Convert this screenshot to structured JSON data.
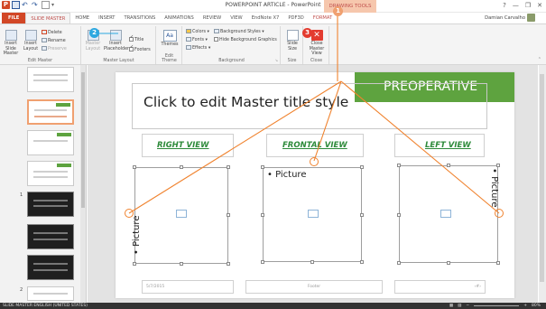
{
  "window": {
    "title": "POWERPOINT ARTICLE - PowerPoint",
    "context_tools": "DRAWING TOOLS",
    "controls": [
      "?",
      "—",
      "❐",
      "✕"
    ]
  },
  "tabs": [
    {
      "label": "FILE",
      "kind": "file"
    },
    {
      "label": "SLIDE MASTER",
      "kind": "active"
    },
    {
      "label": "HOME",
      "kind": ""
    },
    {
      "label": "INSERT",
      "kind": ""
    },
    {
      "label": "TRANSITIONS",
      "kind": ""
    },
    {
      "label": "ANIMATIONS",
      "kind": ""
    },
    {
      "label": "REVIEW",
      "kind": ""
    },
    {
      "label": "VIEW",
      "kind": ""
    },
    {
      "label": "EndNote X7",
      "kind": ""
    },
    {
      "label": "PDF3D",
      "kind": ""
    },
    {
      "label": "FORMAT",
      "kind": "ctx"
    }
  ],
  "user": {
    "name": "Damian Carvalho"
  },
  "ribbon": {
    "edit_master": {
      "label": "Edit Master",
      "insert_slide_master": "Insert Slide Master",
      "insert_layout": "Insert Layout",
      "delete": "Delete",
      "rename": "Rename",
      "preserve": "Preserve"
    },
    "master_layout": {
      "label": "Master Layout",
      "master_layout_btn": "Master Layout",
      "insert_placeholder": "Insert Placeholder",
      "title": "Title",
      "footers": "Footers"
    },
    "edit_theme": {
      "label": "Edit Theme",
      "themes": "Themes"
    },
    "background": {
      "label": "Background",
      "colors": "Colors",
      "fonts": "Fonts",
      "effects": "Effects",
      "background_styles": "Background Styles",
      "hide_background_graphics": "Hide Background Graphics"
    },
    "size": {
      "label": "Size",
      "slide_size": "Slide Size"
    },
    "close": {
      "label": "Close",
      "close_master_view": "Close Master View"
    }
  },
  "thumbnails": {
    "numbers": [
      "1",
      "2"
    ]
  },
  "slide": {
    "banner": "PREOPERATIVE",
    "title_placeholder": "Click to edit Master title style",
    "views": [
      "RIGHT VIEW",
      "FRONTAL VIEW",
      "LEFT VIEW"
    ],
    "picture_left": "• Picture",
    "picture_middle": "• Picture",
    "picture_right": "• Picture",
    "footer_date": "5/7/2015",
    "footer_text": "Footer",
    "footer_number": "‹#›"
  },
  "badges": {
    "b1": "1",
    "b2": "2",
    "b3": "3"
  },
  "status": {
    "left": "SLIDE MASTER   ENGLISH (UNITED STATES)",
    "zoom": "80%"
  },
  "colors": {
    "accent": "#d24726",
    "banner_green": "#5ea33f",
    "view_green": "#2d8a3a",
    "annotation_orange": "#f0832f",
    "badge_blue": "#2da8e0",
    "badge_red": "#e33b2f"
  }
}
